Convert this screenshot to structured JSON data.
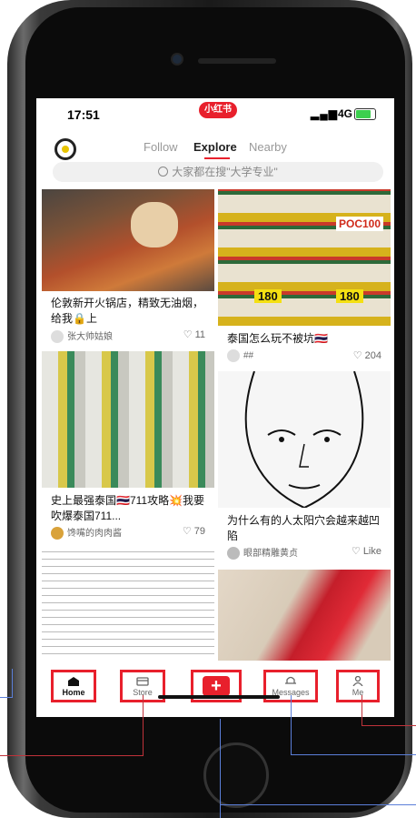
{
  "status": {
    "time": "17:51",
    "app_badge": "小红书",
    "network": "4G"
  },
  "tabs": [
    {
      "label": "Follow"
    },
    {
      "label": "Explore"
    },
    {
      "label": "Nearby"
    }
  ],
  "search": {
    "placeholder": "大家都在搜\"大学专业\""
  },
  "cards": [
    {
      "title": "伦敦新开火锅店，精致无油烟，给我🔒上",
      "author": "张大帅姑娘",
      "likes": "11"
    },
    {
      "title": "泰国怎么玩不被坑🇹🇭",
      "author": "##",
      "likes": "204"
    },
    {
      "title": "史上最强泰国🇹🇭711攻略💥我要吹爆泰国711...",
      "author": "馋嘴的肉肉酱",
      "likes": "79"
    },
    {
      "title": "为什么有的人太阳穴会越来越凹陷",
      "author": "眼部精雕黄贞",
      "likes": "Like"
    }
  ],
  "image_labels": {
    "poc": "POC100",
    "price1": "180",
    "price2": "180"
  },
  "bottom_nav": [
    {
      "label": "Home"
    },
    {
      "label": "Store"
    },
    {
      "label": "+"
    },
    {
      "label": "Messages"
    },
    {
      "label": "Me"
    }
  ],
  "colors": {
    "accent": "#e8202c",
    "annotation_blue": "#5b7fd9",
    "annotation_red": "#c0323a"
  }
}
